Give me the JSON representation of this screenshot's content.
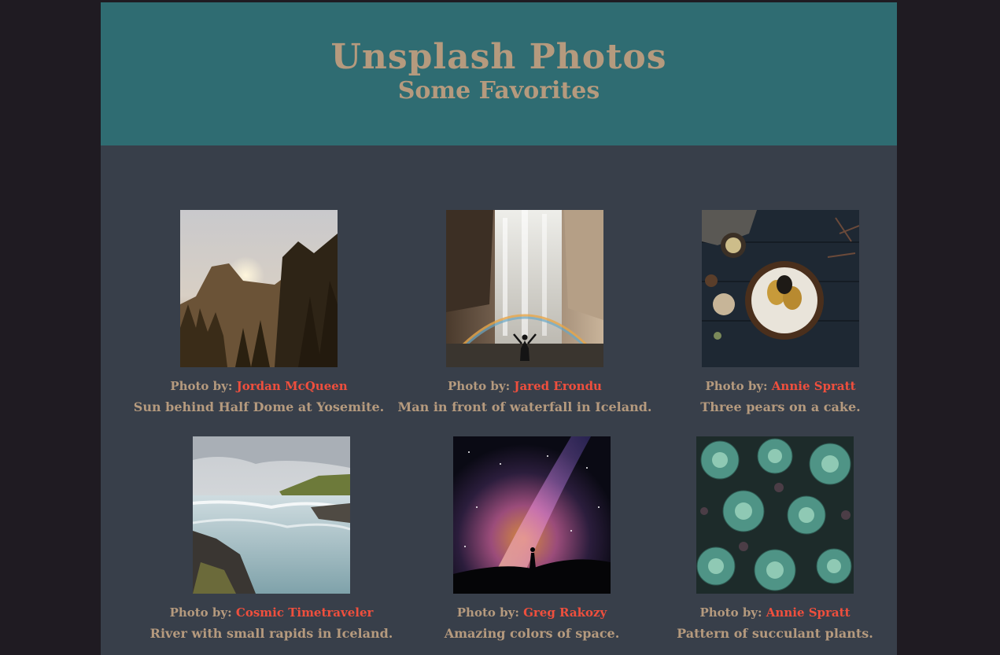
{
  "header": {
    "title": "Unsplash Photos",
    "subtitle": "Some Favorites"
  },
  "photos": [
    {
      "credit_prefix": "Photo by:",
      "author": "Jordan McQueen",
      "caption": "Sun behind Half Dome at Yosemite."
    },
    {
      "credit_prefix": "Photo by:",
      "author": "Jared Erondu",
      "caption": "Man in front of waterfall in Iceland."
    },
    {
      "credit_prefix": "Photo by:",
      "author": "Annie Spratt",
      "caption": "Three pears on a cake."
    },
    {
      "credit_prefix": "Photo by:",
      "author": "Cosmic Timetraveler",
      "caption": "River with small rapids in Iceland."
    },
    {
      "credit_prefix": "Photo by:",
      "author": "Greg Rakozy",
      "caption": "Amazing colors of space."
    },
    {
      "credit_prefix": "Photo by:",
      "author": "Annie Spratt",
      "caption": "Pattern of succulant plants."
    }
  ],
  "colors": {
    "page_background": "#1f1b22",
    "content_background": "#383f4a",
    "header_background": "#2f6c72",
    "text_tan": "#b59a7e",
    "link_red": "#ef4f3d"
  }
}
